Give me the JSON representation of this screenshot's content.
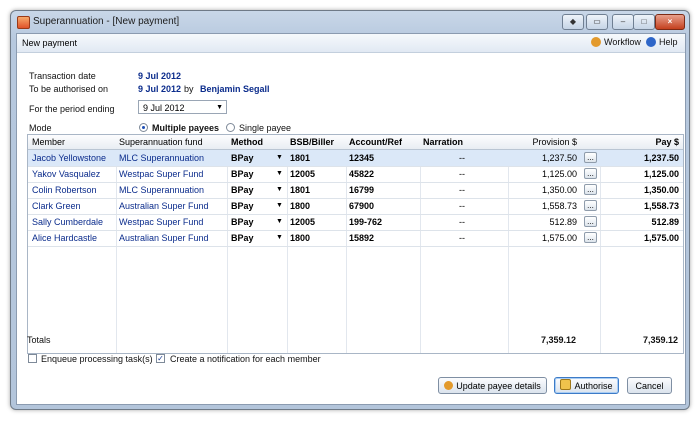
{
  "window": {
    "title": "Superannuation - [New payment]",
    "close_glyph": "×",
    "minimize_glyph": "–",
    "maximize_glyph": "□",
    "restore_glyph": "▭",
    "extra_glyph": "◆"
  },
  "header": {
    "title": "New payment",
    "workflow": "Workflow",
    "help": "Help"
  },
  "form": {
    "transaction_date_label": "Transaction date",
    "transaction_date": "9 Jul 2012",
    "authorise_label": "To be authorised on",
    "authorise_date": "9 Jul 2012",
    "by": "by",
    "authoriser": "Benjamin Segall",
    "period_label": "For the period ending",
    "period_value": "9 Jul 2012",
    "mode_label": "Mode",
    "mode_multiple": "Multiple payees",
    "mode_single": "Single payee"
  },
  "grid": {
    "columns": [
      "Member",
      "Superannuation fund",
      "Method",
      "BSB/Biller",
      "Account/Ref",
      "Narration",
      "Provision $",
      "Pay $"
    ],
    "rows": [
      {
        "member": "Jacob Yellowstone",
        "fund": "MLC Superannuation",
        "method": "BPay",
        "bsb": "1801",
        "account": "12345",
        "narration": "--",
        "provision": "1,237.50",
        "pay": "1,237.50"
      },
      {
        "member": "Yakov Vasqualez",
        "fund": "Westpac Super Fund",
        "method": "BPay",
        "bsb": "12005",
        "account": "45822",
        "narration": "--",
        "provision": "1,125.00",
        "pay": "1,125.00"
      },
      {
        "member": "Colin Robertson",
        "fund": "MLC Superannuation",
        "method": "BPay",
        "bsb": "1801",
        "account": "16799",
        "narration": "--",
        "provision": "1,350.00",
        "pay": "1,350.00"
      },
      {
        "member": "Clark Green",
        "fund": "Australian Super Fund",
        "method": "BPay",
        "bsb": "1800",
        "account": "67900",
        "narration": "--",
        "provision": "1,558.73",
        "pay": "1,558.73"
      },
      {
        "member": "Sally Cumberdale",
        "fund": "Westpac Super Fund",
        "method": "BPay",
        "bsb": "12005",
        "account": "199-762",
        "narration": "--",
        "provision": "512.89",
        "pay": "512.89"
      },
      {
        "member": "Alice Hardcastle",
        "fund": "Australian Super Fund",
        "method": "BPay",
        "bsb": "1800",
        "account": "15892",
        "narration": "--",
        "provision": "1,575.00",
        "pay": "1,575.00"
      }
    ],
    "ellipsis": "...",
    "dropdown_glyph": "▼"
  },
  "totals": {
    "label": "Totals",
    "provision": "7,359.12",
    "pay": "7,359.12"
  },
  "options": {
    "enqueue": "Enqueue processing task(s)",
    "enqueue_checked": false,
    "notify": "Create a notification for each member",
    "notify_checked": true,
    "check_glyph": "✓"
  },
  "buttons": {
    "update": "Update payee details",
    "authorise": "Authorise",
    "cancel": "Cancel"
  },
  "colors": {
    "accent": "#0b2c8c",
    "selection": "#dbe8f8",
    "title_gradient": "#c9d7e8"
  }
}
